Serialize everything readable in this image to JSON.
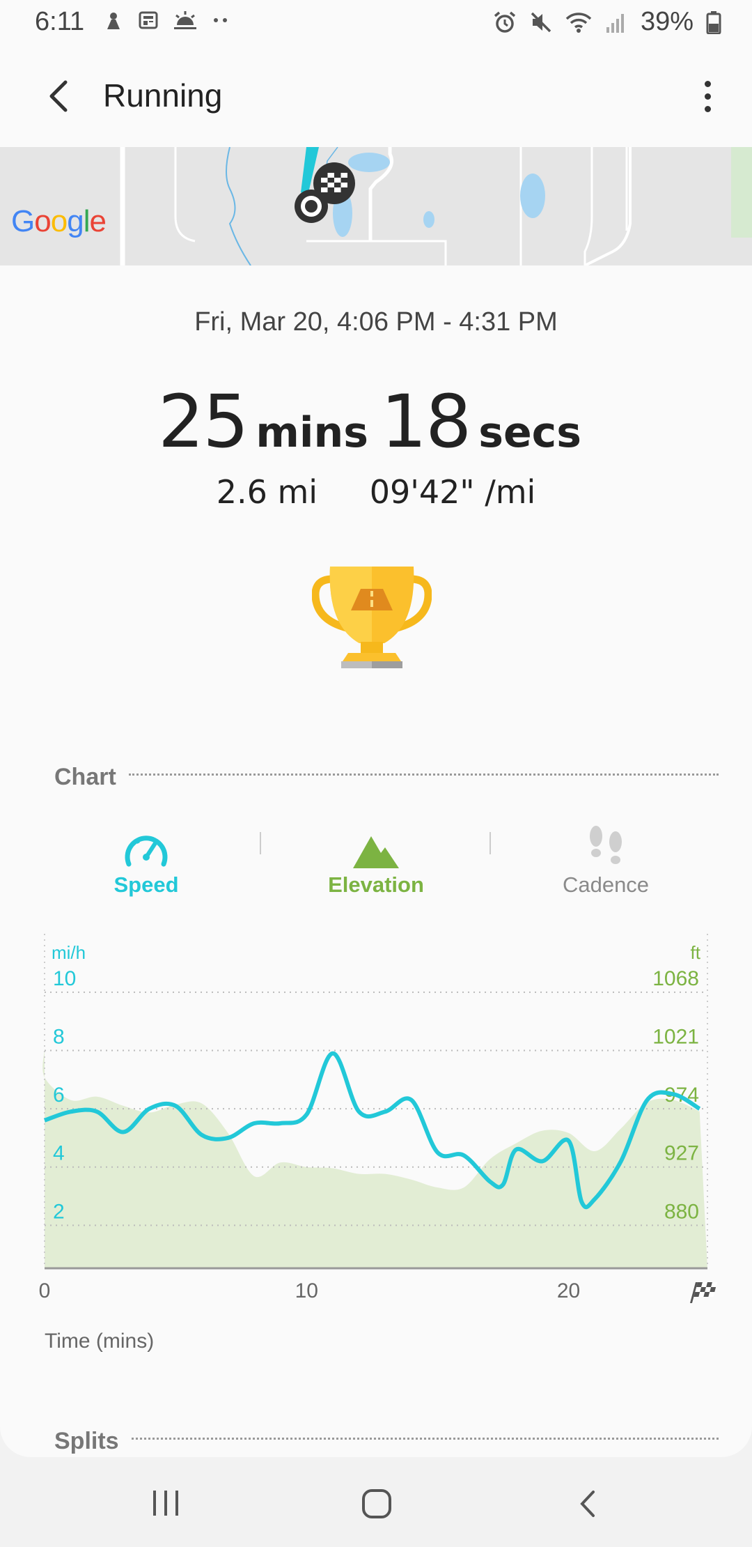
{
  "status_bar": {
    "time": "6:11",
    "battery": "39%"
  },
  "app_bar": {
    "title": "Running"
  },
  "map": {
    "provider_logo": "Google"
  },
  "workout": {
    "date_range": "Fri, Mar 20, 4:06 PM - 4:31 PM",
    "duration_mins_value": "25",
    "duration_mins_unit": "mins",
    "duration_secs_value": "18",
    "duration_secs_unit": "secs",
    "distance": "2.6 mi",
    "pace": "09'42\" /mi"
  },
  "chart_section": {
    "title": "Chart"
  },
  "chart_tabs": [
    {
      "label": "Speed",
      "icon": "speedometer-icon",
      "color": "#22c8d8",
      "active": true
    },
    {
      "label": "Elevation",
      "icon": "mountain-icon",
      "color": "#7cb342",
      "active": true
    },
    {
      "label": "Cadence",
      "icon": "footsteps-icon",
      "color": "#8a8a8a",
      "active": false
    }
  ],
  "chart_data": {
    "type": "line",
    "xlabel": "Time (mins)",
    "x_ticks": [
      "0",
      "10",
      "20"
    ],
    "xlim": [
      0,
      25.3
    ],
    "left_axis": {
      "unit": "mi/h",
      "ticks": [
        "10",
        "8",
        "6",
        "4",
        "2"
      ],
      "ylim": [
        0,
        11
      ],
      "color": "#22c8d8"
    },
    "right_axis": {
      "unit": "ft",
      "ticks": [
        "1068",
        "1021",
        "974",
        "927",
        "880"
      ],
      "ylim": [
        833,
        1115
      ],
      "color": "#7cb342"
    },
    "series": [
      {
        "axis": "left",
        "type": "line",
        "x": [
          0,
          1,
          2,
          3,
          4,
          5,
          6,
          7,
          8,
          9,
          10,
          11,
          12,
          13,
          14,
          15,
          16,
          17,
          17.5,
          18,
          19,
          20,
          20.5,
          21,
          22,
          23,
          24,
          25
        ],
        "y": [
          5.6,
          5.9,
          5.9,
          5.2,
          6.0,
          6.1,
          5.1,
          5.0,
          5.5,
          5.5,
          5.8,
          7.9,
          5.9,
          5.9,
          6.3,
          4.5,
          4.4,
          3.5,
          3.4,
          4.6,
          4.2,
          4.9,
          2.8,
          2.9,
          4.2,
          6.3,
          6.5,
          6.0
        ]
      },
      {
        "axis": "right",
        "type": "area",
        "x": [
          0,
          1,
          2,
          3,
          4,
          5,
          6,
          7,
          8,
          9,
          10,
          11,
          12,
          13,
          14,
          15,
          16,
          17,
          18,
          19,
          20,
          21,
          22,
          23,
          24,
          25
        ],
        "y": [
          1001,
          981,
          984,
          976,
          970,
          977,
          978,
          952,
          914,
          926,
          922,
          921,
          916,
          916,
          911,
          904,
          904,
          929,
          943,
          954,
          952,
          936,
          956,
          979,
          981,
          971
        ]
      }
    ]
  },
  "splits_section": {
    "title": "Splits"
  }
}
